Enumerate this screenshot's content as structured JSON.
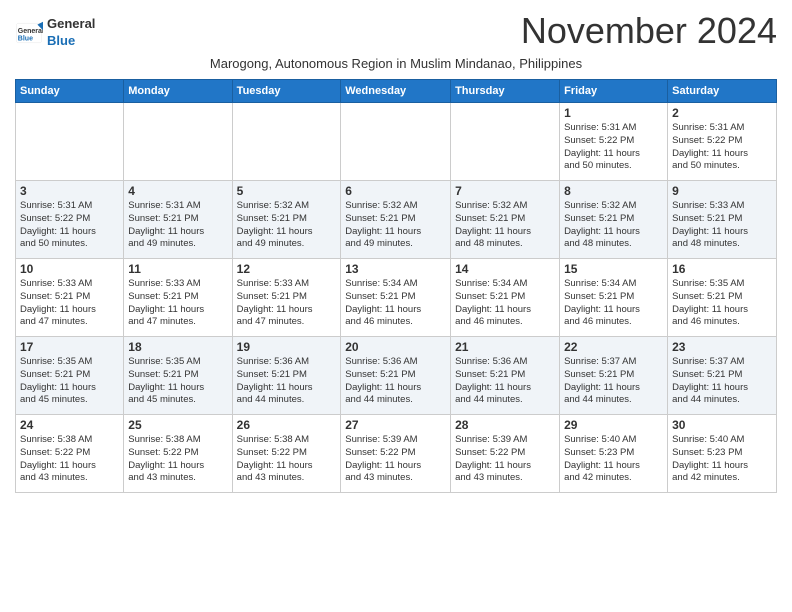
{
  "logo": {
    "line1": "General",
    "line2": "Blue"
  },
  "title": "November 2024",
  "subtitle": "Marogong, Autonomous Region in Muslim Mindanao, Philippines",
  "weekdays": [
    "Sunday",
    "Monday",
    "Tuesday",
    "Wednesday",
    "Thursday",
    "Friday",
    "Saturday"
  ],
  "weeks": [
    [
      {
        "day": "",
        "info": ""
      },
      {
        "day": "",
        "info": ""
      },
      {
        "day": "",
        "info": ""
      },
      {
        "day": "",
        "info": ""
      },
      {
        "day": "",
        "info": ""
      },
      {
        "day": "1",
        "info": "Sunrise: 5:31 AM\nSunset: 5:22 PM\nDaylight: 11 hours\nand 50 minutes."
      },
      {
        "day": "2",
        "info": "Sunrise: 5:31 AM\nSunset: 5:22 PM\nDaylight: 11 hours\nand 50 minutes."
      }
    ],
    [
      {
        "day": "3",
        "info": "Sunrise: 5:31 AM\nSunset: 5:22 PM\nDaylight: 11 hours\nand 50 minutes."
      },
      {
        "day": "4",
        "info": "Sunrise: 5:31 AM\nSunset: 5:21 PM\nDaylight: 11 hours\nand 49 minutes."
      },
      {
        "day": "5",
        "info": "Sunrise: 5:32 AM\nSunset: 5:21 PM\nDaylight: 11 hours\nand 49 minutes."
      },
      {
        "day": "6",
        "info": "Sunrise: 5:32 AM\nSunset: 5:21 PM\nDaylight: 11 hours\nand 49 minutes."
      },
      {
        "day": "7",
        "info": "Sunrise: 5:32 AM\nSunset: 5:21 PM\nDaylight: 11 hours\nand 48 minutes."
      },
      {
        "day": "8",
        "info": "Sunrise: 5:32 AM\nSunset: 5:21 PM\nDaylight: 11 hours\nand 48 minutes."
      },
      {
        "day": "9",
        "info": "Sunrise: 5:33 AM\nSunset: 5:21 PM\nDaylight: 11 hours\nand 48 minutes."
      }
    ],
    [
      {
        "day": "10",
        "info": "Sunrise: 5:33 AM\nSunset: 5:21 PM\nDaylight: 11 hours\nand 47 minutes."
      },
      {
        "day": "11",
        "info": "Sunrise: 5:33 AM\nSunset: 5:21 PM\nDaylight: 11 hours\nand 47 minutes."
      },
      {
        "day": "12",
        "info": "Sunrise: 5:33 AM\nSunset: 5:21 PM\nDaylight: 11 hours\nand 47 minutes."
      },
      {
        "day": "13",
        "info": "Sunrise: 5:34 AM\nSunset: 5:21 PM\nDaylight: 11 hours\nand 46 minutes."
      },
      {
        "day": "14",
        "info": "Sunrise: 5:34 AM\nSunset: 5:21 PM\nDaylight: 11 hours\nand 46 minutes."
      },
      {
        "day": "15",
        "info": "Sunrise: 5:34 AM\nSunset: 5:21 PM\nDaylight: 11 hours\nand 46 minutes."
      },
      {
        "day": "16",
        "info": "Sunrise: 5:35 AM\nSunset: 5:21 PM\nDaylight: 11 hours\nand 46 minutes."
      }
    ],
    [
      {
        "day": "17",
        "info": "Sunrise: 5:35 AM\nSunset: 5:21 PM\nDaylight: 11 hours\nand 45 minutes."
      },
      {
        "day": "18",
        "info": "Sunrise: 5:35 AM\nSunset: 5:21 PM\nDaylight: 11 hours\nand 45 minutes."
      },
      {
        "day": "19",
        "info": "Sunrise: 5:36 AM\nSunset: 5:21 PM\nDaylight: 11 hours\nand 44 minutes."
      },
      {
        "day": "20",
        "info": "Sunrise: 5:36 AM\nSunset: 5:21 PM\nDaylight: 11 hours\nand 44 minutes."
      },
      {
        "day": "21",
        "info": "Sunrise: 5:36 AM\nSunset: 5:21 PM\nDaylight: 11 hours\nand 44 minutes."
      },
      {
        "day": "22",
        "info": "Sunrise: 5:37 AM\nSunset: 5:21 PM\nDaylight: 11 hours\nand 44 minutes."
      },
      {
        "day": "23",
        "info": "Sunrise: 5:37 AM\nSunset: 5:21 PM\nDaylight: 11 hours\nand 44 minutes."
      }
    ],
    [
      {
        "day": "24",
        "info": "Sunrise: 5:38 AM\nSunset: 5:22 PM\nDaylight: 11 hours\nand 43 minutes."
      },
      {
        "day": "25",
        "info": "Sunrise: 5:38 AM\nSunset: 5:22 PM\nDaylight: 11 hours\nand 43 minutes."
      },
      {
        "day": "26",
        "info": "Sunrise: 5:38 AM\nSunset: 5:22 PM\nDaylight: 11 hours\nand 43 minutes."
      },
      {
        "day": "27",
        "info": "Sunrise: 5:39 AM\nSunset: 5:22 PM\nDaylight: 11 hours\nand 43 minutes."
      },
      {
        "day": "28",
        "info": "Sunrise: 5:39 AM\nSunset: 5:22 PM\nDaylight: 11 hours\nand 43 minutes."
      },
      {
        "day": "29",
        "info": "Sunrise: 5:40 AM\nSunset: 5:23 PM\nDaylight: 11 hours\nand 42 minutes."
      },
      {
        "day": "30",
        "info": "Sunrise: 5:40 AM\nSunset: 5:23 PM\nDaylight: 11 hours\nand 42 minutes."
      }
    ]
  ]
}
